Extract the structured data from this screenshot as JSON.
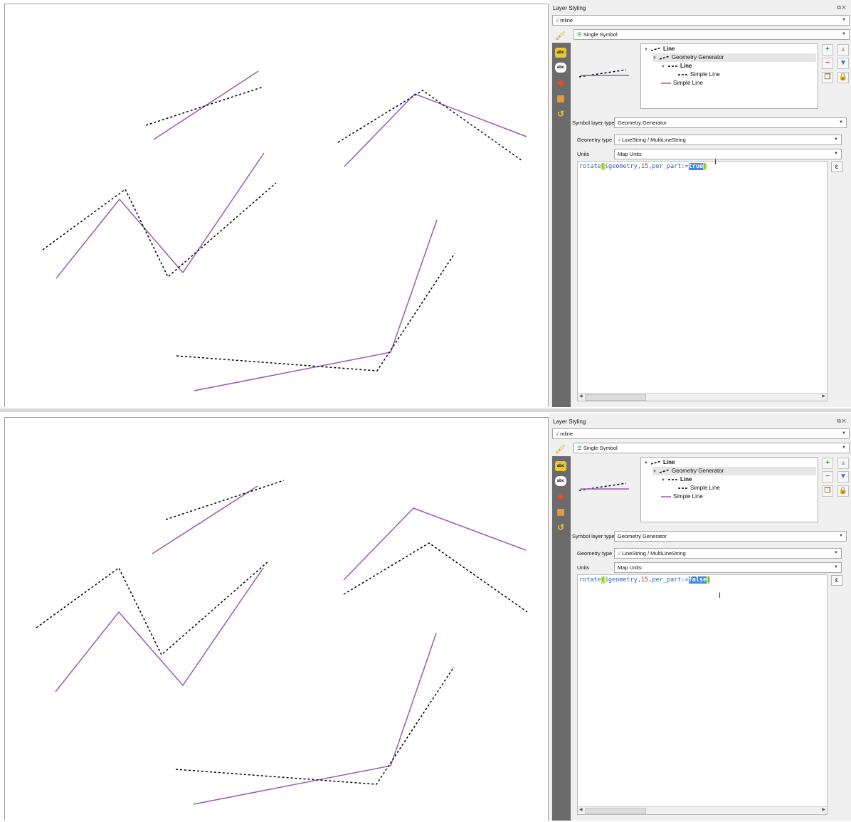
{
  "screens": [
    {
      "panel_title": "Layer Styling",
      "layer_combo": "mline",
      "renderer_combo": "Single Symbol",
      "tree": [
        "Line",
        "Geometry Generator",
        "Line",
        "Simple Line",
        "Simple Line"
      ],
      "symbol_layer_type_label": "Symbol layer type",
      "symbol_layer_type_value": "Geometry Generator",
      "geometry_type_label": "Geometry type",
      "geometry_type_value": "LineString / MultiLineString",
      "units_label": "Units",
      "units_value": "Map Units",
      "expression": {
        "fn": "rotate",
        "open": "(",
        "var": "$",
        "var2": "geometry",
        "c1": ",",
        "num": "15",
        "c2": ",",
        "param": "per_part",
        "op": ":=",
        "value": "true",
        "close": ")"
      }
    },
    {
      "panel_title": "Layer Styling",
      "layer_combo": "mline",
      "renderer_combo": "Single Symbol",
      "tree": [
        "Line",
        "Geometry Generator",
        "Line",
        "Simple Line",
        "Simple Line"
      ],
      "symbol_layer_type_label": "Symbol layer type",
      "symbol_layer_type_value": "Geometry Generator",
      "geometry_type_label": "Geometry type",
      "geometry_type_value": "LineString / MultiLineString",
      "units_label": "Units",
      "units_value": "Map Units",
      "expression": {
        "fn": "rotate",
        "open": "(",
        "var": "$",
        "var2": "geometry",
        "c1": ",",
        "num": "15",
        "c2": ",",
        "param": "per_part",
        "op": ":=",
        "value": "false",
        "close": ")"
      }
    }
  ],
  "colors": {
    "original_line": "#9b59b6",
    "rotated_line": "#000000",
    "sidebar": "#6b6b6b"
  },
  "icons": [
    "mline-layer-icon",
    "single-symbol-icon",
    "paintbrush-icon",
    "labels-icon",
    "labels-abc-icon",
    "3d-view-icon",
    "diagrams-icon",
    "history-icon",
    "add-symbol-layer-icon",
    "remove-symbol-layer-icon",
    "move-up-icon",
    "move-down-icon",
    "duplicate-icon",
    "lock-icon",
    "expression-epsilon-icon"
  ]
}
